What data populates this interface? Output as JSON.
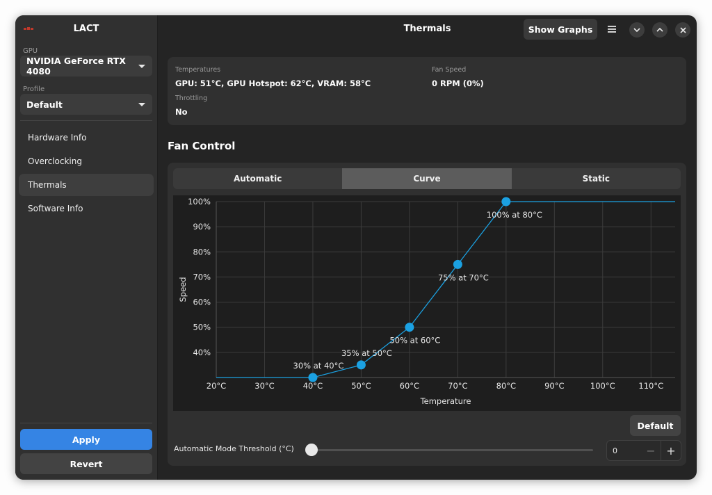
{
  "app": {
    "title": "LACT",
    "header_title": "Thermals",
    "show_graphs_label": "Show Graphs"
  },
  "sidebar": {
    "gpu_label": "GPU",
    "gpu_value": "NVIDIA GeForce RTX 4080",
    "profile_label": "Profile",
    "profile_value": "Default",
    "items": [
      {
        "label": "Hardware Info"
      },
      {
        "label": "Overclocking"
      },
      {
        "label": "Thermals",
        "active": true
      },
      {
        "label": "Software Info"
      }
    ],
    "apply_label": "Apply",
    "revert_label": "Revert"
  },
  "stats": {
    "temperatures_label": "Temperatures",
    "temperatures_value": "GPU: 51°C, GPU Hotspot: 62°C, VRAM: 58°C",
    "fan_speed_label": "Fan Speed",
    "fan_speed_value": "0 RPM (0%)",
    "throttling_label": "Throttling",
    "throttling_value": "No"
  },
  "fan_control": {
    "title": "Fan Control",
    "tabs": [
      {
        "label": "Automatic"
      },
      {
        "label": "Curve",
        "selected": true
      },
      {
        "label": "Static"
      }
    ],
    "default_label": "Default",
    "threshold_label": "Automatic Mode Threshold (°C)",
    "threshold_value": "0",
    "threshold_slider": 0
  },
  "colors": {
    "accent": "#3584e4",
    "curve": "#1ba1e2"
  },
  "chart_data": {
    "type": "line",
    "xlabel": "Temperature",
    "ylabel": "Speed",
    "xlim": [
      20,
      115
    ],
    "ylim": [
      30,
      100
    ],
    "x_ticks": [
      "20°C",
      "30°C",
      "40°C",
      "50°C",
      "60°C",
      "70°C",
      "80°C",
      "90°C",
      "100°C",
      "110°C"
    ],
    "y_ticks": [
      "40%",
      "50%",
      "60%",
      "70%",
      "80%",
      "90%",
      "100%"
    ],
    "grid": true,
    "points": [
      {
        "x": 40,
        "y": 30,
        "label": "30% at 40°C"
      },
      {
        "x": 50,
        "y": 35,
        "label": "35% at 50°C"
      },
      {
        "x": 60,
        "y": 50,
        "label": "50% at 60°C"
      },
      {
        "x": 70,
        "y": 75,
        "label": "75% at 70°C"
      },
      {
        "x": 80,
        "y": 100,
        "label": "100% at 80°C"
      }
    ],
    "extend_left_to": 20,
    "extend_right_to": 115
  }
}
